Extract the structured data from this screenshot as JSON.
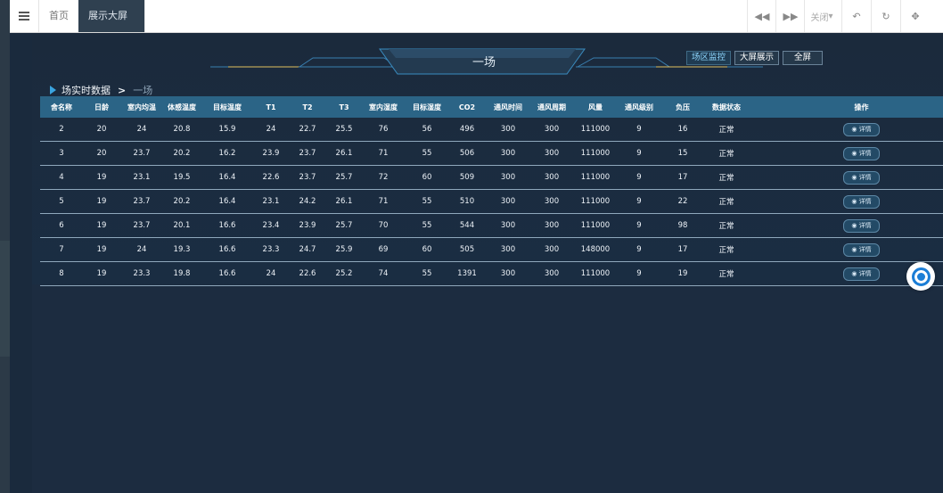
{
  "topbar": {
    "tabs": [
      {
        "label": "首页"
      },
      {
        "label": "展示大屏"
      }
    ],
    "close_label": "关闭"
  },
  "header": {
    "title": "一场",
    "buttons": [
      "场区监控",
      "大屏展示",
      "全屏"
    ]
  },
  "breadcrumb": {
    "main": "场实时数据",
    "sep": ">",
    "sub": "一场"
  },
  "table": {
    "columns": [
      "舍名称",
      "日龄",
      "室内均温",
      "体感温度",
      "目标温度",
      "T1",
      "T2",
      "T3",
      "室内湿度",
      "目标湿度",
      "CO2",
      "通风时间",
      "通风周期",
      "风量",
      "通风级别",
      "负压",
      "数据状态",
      "操作"
    ],
    "detail_label": "详情",
    "rows": [
      [
        "2",
        "20",
        "24",
        "20.8",
        "15.9",
        "24",
        "22.7",
        "25.5",
        "76",
        "56",
        "496",
        "300",
        "300",
        "111000",
        "9",
        "16",
        "正常"
      ],
      [
        "3",
        "20",
        "23.7",
        "20.2",
        "16.2",
        "23.9",
        "23.7",
        "26.1",
        "71",
        "55",
        "506",
        "300",
        "300",
        "111000",
        "9",
        "15",
        "正常"
      ],
      [
        "4",
        "19",
        "23.1",
        "19.5",
        "16.4",
        "22.6",
        "23.7",
        "25.7",
        "72",
        "60",
        "509",
        "300",
        "300",
        "111000",
        "9",
        "17",
        "正常"
      ],
      [
        "5",
        "19",
        "23.7",
        "20.2",
        "16.4",
        "23.1",
        "24.2",
        "26.1",
        "71",
        "55",
        "510",
        "300",
        "300",
        "111000",
        "9",
        "22",
        "正常"
      ],
      [
        "6",
        "19",
        "23.7",
        "20.1",
        "16.6",
        "23.4",
        "23.9",
        "25.7",
        "70",
        "55",
        "544",
        "300",
        "300",
        "111000",
        "9",
        "98",
        "正常"
      ],
      [
        "7",
        "19",
        "24",
        "19.3",
        "16.6",
        "23.3",
        "24.7",
        "25.9",
        "69",
        "60",
        "505",
        "300",
        "300",
        "148000",
        "9",
        "17",
        "正常"
      ],
      [
        "8",
        "19",
        "23.3",
        "19.8",
        "16.6",
        "24",
        "22.6",
        "25.2",
        "74",
        "55",
        "1391",
        "300",
        "300",
        "111000",
        "9",
        "19",
        "正常"
      ]
    ]
  }
}
